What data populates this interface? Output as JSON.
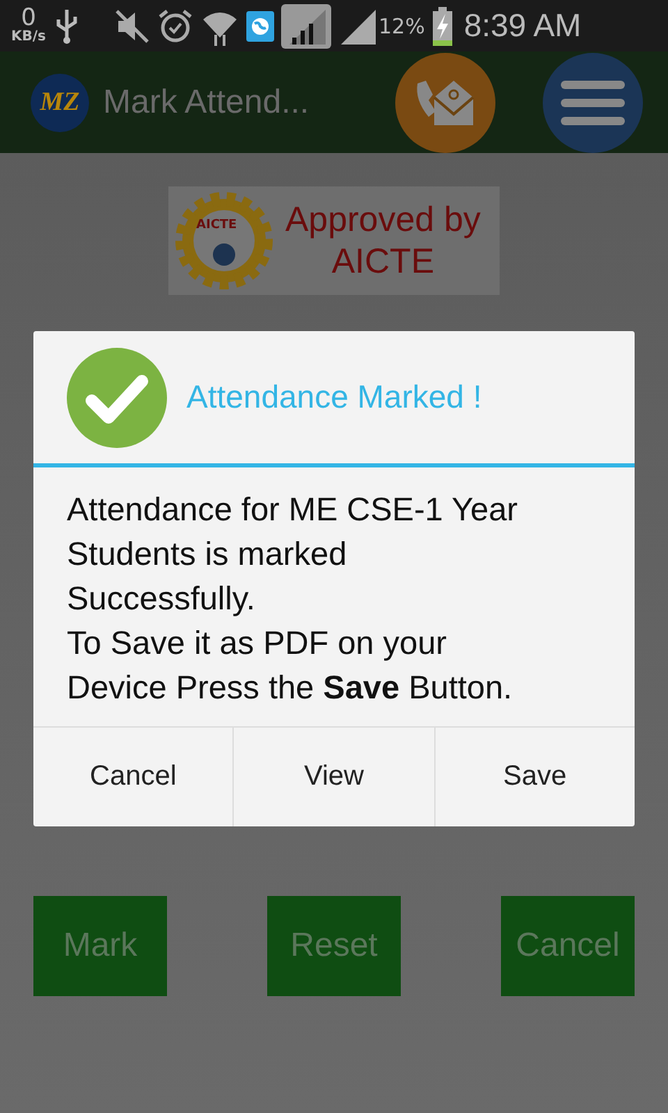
{
  "status_bar": {
    "speed_value": "0",
    "speed_unit": "KB/s",
    "battery_percent": "12%",
    "time": "8:39 AM"
  },
  "app_bar": {
    "logo_text": "MZ",
    "title": "Mark Attend..."
  },
  "banner": {
    "seal_text": "AICTE",
    "text_lines": [
      "Approved by",
      "AICTE"
    ]
  },
  "dialog": {
    "title": "Attendance Marked !",
    "message": "Attendance for ME CSE-1 Year Students is marked Successfully.\nTo Save it as PDF on your Device Press the **Save** Button.",
    "buttons": [
      "Cancel",
      "View",
      "Save"
    ]
  },
  "actions": [
    "Mark",
    "Reset",
    "Cancel"
  ]
}
